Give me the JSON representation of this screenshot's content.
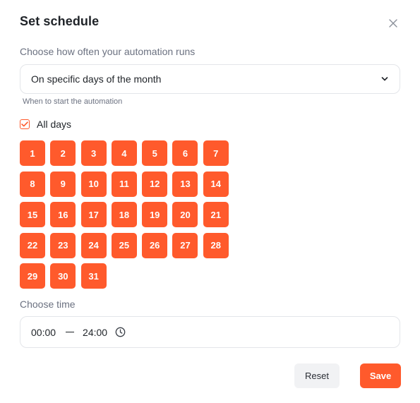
{
  "dialog": {
    "title": "Set schedule"
  },
  "frequency": {
    "label": "Choose how often your automation runs",
    "selected": "On specific days of the month",
    "helper": "When to start the automation"
  },
  "all_days": {
    "label": "All days",
    "checked": true
  },
  "days": [
    "1",
    "2",
    "3",
    "4",
    "5",
    "6",
    "7",
    "8",
    "9",
    "10",
    "11",
    "12",
    "13",
    "14",
    "15",
    "16",
    "17",
    "18",
    "19",
    "20",
    "21",
    "22",
    "23",
    "24",
    "25",
    "26",
    "27",
    "28",
    "29",
    "30",
    "31"
  ],
  "time": {
    "label": "Choose time",
    "start": "00:00",
    "end": "24:00"
  },
  "actions": {
    "reset_label": "Reset",
    "save_label": "Save"
  },
  "colors": {
    "accent": "#ff5a2c",
    "border": "#e3e5e9",
    "muted_text": "#6b7180"
  },
  "icons": {
    "close": "close-icon",
    "chevron": "chevron-down-icon",
    "check": "check-icon",
    "clock": "clock-icon"
  }
}
